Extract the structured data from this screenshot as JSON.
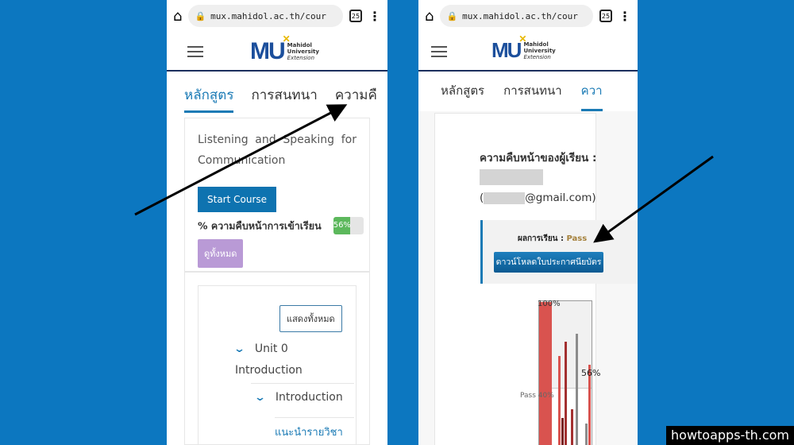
{
  "browser": {
    "url": "mux.mahidol.ac.th/cour",
    "tab_count": "25"
  },
  "logo": {
    "mark": "MU",
    "line1": "Mahidol",
    "line2": "University",
    "line3": "Extension"
  },
  "left": {
    "tabs": [
      "หลักสูตร",
      "การสนทนา",
      "ความคื"
    ],
    "course_title": "Listening and Speaking for Communication",
    "start_button": "Start Course",
    "progress_label": "% ความคืบหน้าการเข้าเรียน",
    "progress_value": "56%",
    "progress_percent": 56,
    "view_all_button": "ดูทั้งหมด",
    "show_all_button": "แสดงทั้งหมด",
    "unit_title": "Unit 0 Introduction",
    "section_title": "Introduction",
    "lesson_link": "แนะนำรายวิชา"
  },
  "right": {
    "tabs": [
      "หลักสูตร",
      "การสนทนา",
      "ควา"
    ],
    "progress_heading": "ความคืบหน้าของผู้เรียน :",
    "email_suffix": "@gmail.com)",
    "email_prefix": "(",
    "result_label": "ผลการเรียน :",
    "result_value": "Pass",
    "download_button": "ดาวน์โหลดใบประกาศนียบัตร",
    "chart": {
      "top_label": "100%",
      "pass_label": "Pass",
      "pass_value": "40%",
      "current_label": "56%"
    }
  },
  "chart_data": {
    "type": "bar",
    "values": [
      100,
      100,
      100,
      100,
      62,
      19,
      72,
      25,
      78,
      15,
      56
    ],
    "colors": [
      "#d9534f",
      "#d9534f",
      "#d9534f",
      "#d9534f",
      "#d9534f",
      "#7a1f1f",
      "#a33030",
      "#a33030",
      "#8c8c8c",
      "#8c8c8c",
      "#d9534f"
    ],
    "ylim": [
      0,
      100
    ],
    "pass_line": 40
  },
  "watermark": "howtoapps-th.com",
  "colors": {
    "background": "#0c77c0",
    "accent": "#1a7ab5",
    "progress": "#5cb85c",
    "view_all": "#b99ad6",
    "pass": "#a5813c"
  }
}
